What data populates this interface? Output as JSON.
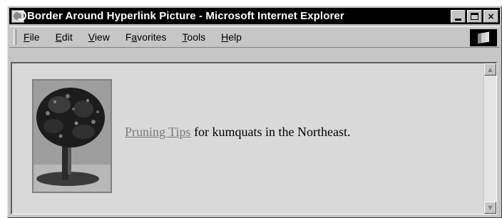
{
  "window": {
    "title": "Border Around Hyperlink Picture - Microsoft Internet Explorer",
    "controls": {
      "minimize": "_",
      "maximize": "□",
      "close": "×"
    }
  },
  "menubar": {
    "items": [
      {
        "label": "File",
        "hotkey": "F",
        "rest": "ile"
      },
      {
        "label": "Edit",
        "hotkey": "E",
        "rest": "dit"
      },
      {
        "label": "View",
        "hotkey": "V",
        "rest": "iew"
      },
      {
        "label": "Favorites",
        "pre": "F",
        "hotkey": "a",
        "rest": "vorites"
      },
      {
        "label": "Tools",
        "hotkey": "T",
        "rest": "ools"
      },
      {
        "label": "Help",
        "hotkey": "H",
        "rest": "elp"
      }
    ]
  },
  "content": {
    "link_text": "Pruning Tips",
    "sentence_rest": " for kumquats in the Northeast.",
    "picture": "tree-picture"
  },
  "scrollbar": {
    "up": "▲",
    "down": "▼"
  },
  "colors": {
    "link": "#7a7a7a",
    "content_bg": "#d9d9d9",
    "chrome": "#c6c6c6",
    "titlebar": "#000000"
  }
}
